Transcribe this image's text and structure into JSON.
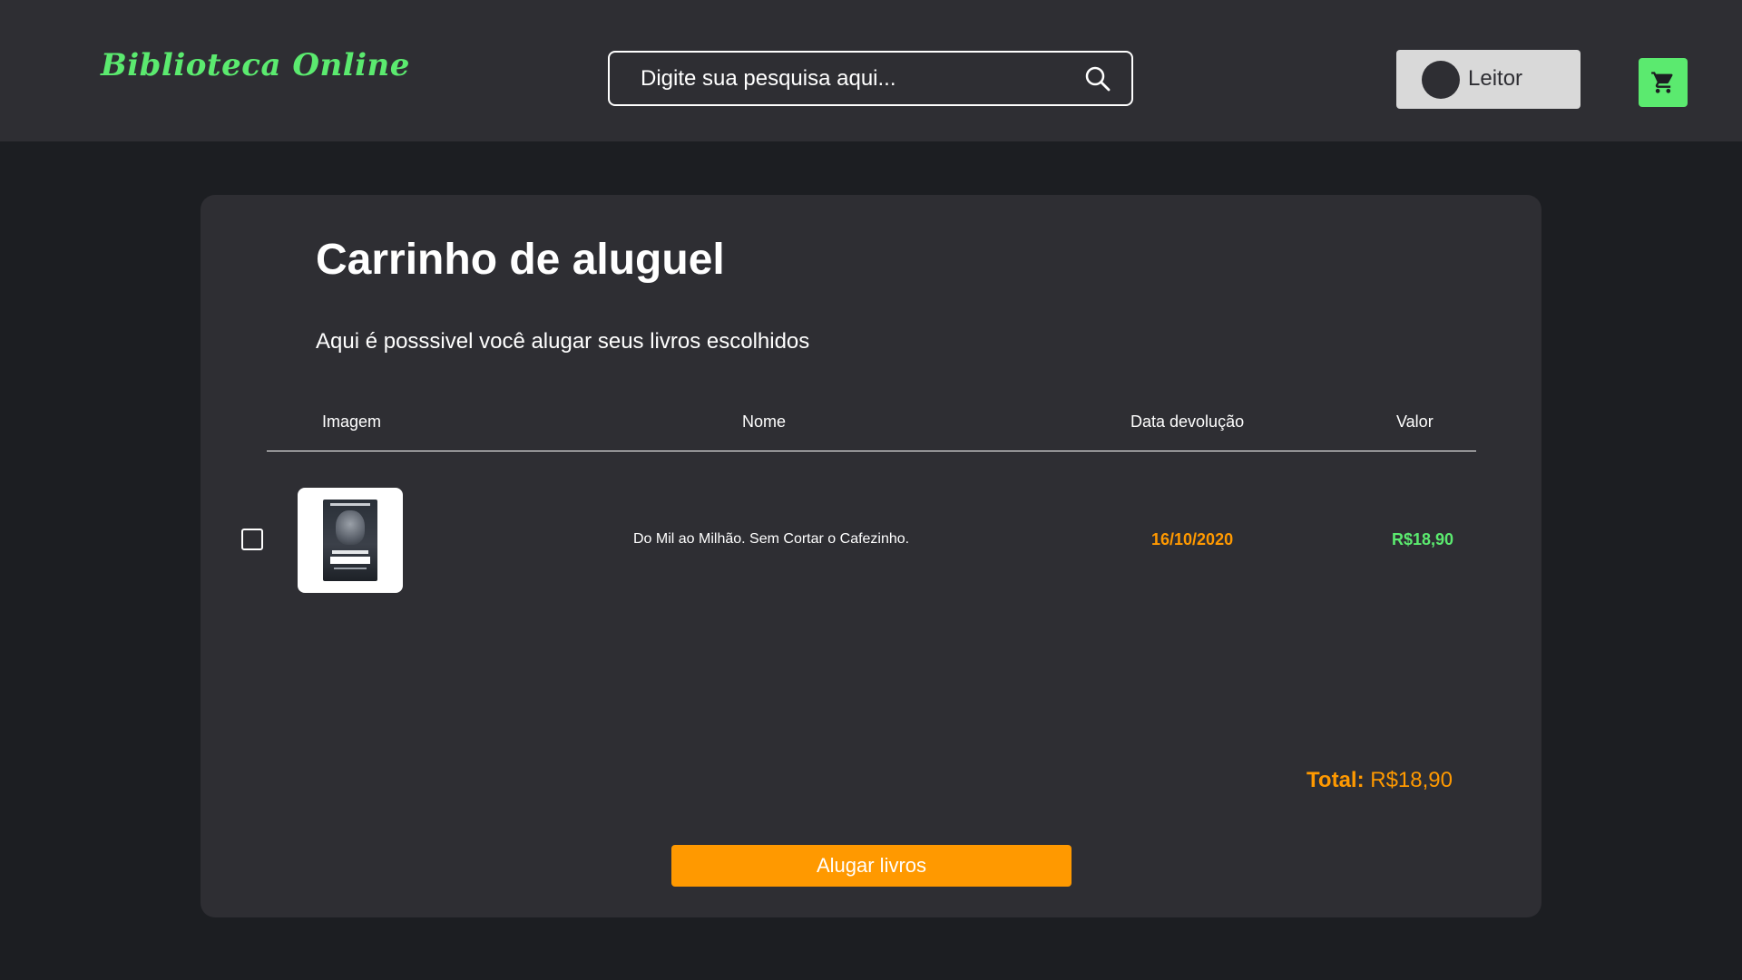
{
  "header": {
    "brand": "Biblioteca Online",
    "search_placeholder": "Digite sua pesquisa aqui...",
    "search_icon": "search-icon",
    "user_label": "Leitor",
    "cart_icon": "shopping-cart-icon"
  },
  "cart": {
    "title": "Carrinho de aluguel",
    "subtitle": "Aqui é posssivel você alugar seus livros escolhidos",
    "columns": {
      "image": "Imagem",
      "name": "Nome",
      "return_date": "Data  devolução",
      "value": "Valor"
    },
    "items": [
      {
        "checked": false,
        "name": "Do Mil ao Milhão. Sem Cortar o Cafezinho.",
        "return_date": "16/10/2020",
        "value": "R$18,90"
      }
    ],
    "total_label": "Total:",
    "total_value": "R$18,90",
    "rent_button": "Alugar livros"
  },
  "colors": {
    "accent_green": "#5bea6f",
    "accent_orange": "#ff9900",
    "header_bg": "#2e2e33",
    "page_bg": "#1c1e22"
  }
}
